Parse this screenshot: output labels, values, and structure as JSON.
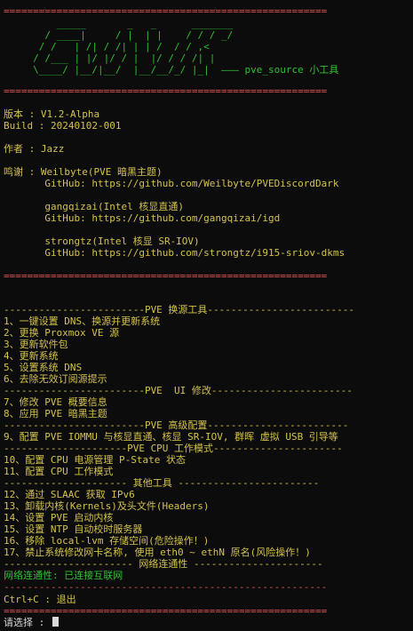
{
  "separator": "=======================================================",
  "logo": {
    "line1": "         _____       _   _      _______",
    "line2": "       / ____|     / |  | |    / / / _/",
    "line3": "      / /   | /| / /| | | /  / / ,<",
    "line4": "     / /___ | |/ |/ / |  |/ / / /| |",
    "line5": "     \\____/ |__/|__/  |__/__/_/ |_|  ——— pve_source 小工具"
  },
  "info": {
    "version": "版本 : V1.2-Alpha",
    "build": "Build : 20240102-001",
    "author": "作者 : Jazz",
    "thanks": "鸣谢 : Weilbyte(PVE 暗黑主题)",
    "github1": "       GitHub: https://github.com/Weilbyte/PVEDiscordDark",
    "credit2": "       gangqizai(Intel 核显直通)",
    "github2": "       GitHub: https://github.com/gangqizai/igd",
    "credit3": "       strongtz(Intel 核显 SR-IOV)",
    "github3": "       GitHub: https://github.com/strongtz/i915-sriov-dkms"
  },
  "sections": {
    "source": "------------------------PVE 换源工具-------------------------",
    "ui": "------------------------PVE  UI 修改------------------------",
    "advanced": "------------------------PVE 高级配置------------------------",
    "cpu": "---------------------PVE CPU 工作模式----------------------",
    "other": "--------------------- 其他工具 ------------------------",
    "network": "---------------------- 网络连通性 ----------------------"
  },
  "menu": {
    "i1": "1、一键设置 DNS、换源并更新系统",
    "i2": "2、更换 Proxmox VE 源",
    "i3": "3、更新软件包",
    "i4": "4、更新系统",
    "i5": "5、设置系统 DNS",
    "i6": "6、去除无效订阅源提示",
    "i7": "7、修改 PVE 概要信息",
    "i8": "8、应用 PVE 暗黑主题",
    "i9": "9、配置 PVE IOMMU 与核显直通、核显 SR-IOV, 群晖 虚拟 USB 引导等",
    "i10": "10、配置 CPU 电源管理 P-State 状态",
    "i11": "11、配置 CPU 工作模式",
    "i12": "12、通过 SLAAC 获取 IPv6",
    "i13": "13、卸载内核(Kernels)及头文件(Headers)",
    "i14": "14、设置 PVE 启动内核",
    "i15": "15、设置 NTP 自动校时服务器",
    "i16": "16、移除 local-lvm 存储空间(危险操作！)",
    "i17": "17、禁止系统修改网卡名称, 使用 eth0 ~ ethN 原名(风险操作！)"
  },
  "status": {
    "network": "网络连通性: 已连接互联网",
    "dash_line": "-------------------------------------------------------",
    "exit": "Ctrl+C : 退出",
    "prompt": "请选择 : "
  }
}
